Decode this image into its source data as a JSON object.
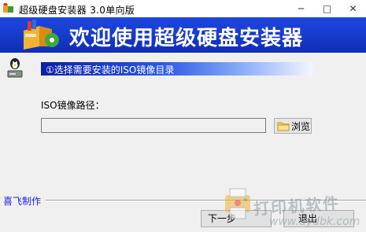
{
  "window": {
    "title": "超级硬盘安装器 3.0单向版",
    "minimize_glyph": "─",
    "maximize_glyph": "□",
    "close_glyph": "✕"
  },
  "banner": {
    "title": "欢迎使用超级硬盘安装器"
  },
  "step": {
    "label": "①选择需要安装的ISO镜像目录"
  },
  "form": {
    "path_label": "ISO镜像路径：",
    "path_value": "",
    "browse_label": "浏览",
    "browse_icon": "folder-icon"
  },
  "footer": {
    "author_link": "喜飞制作",
    "next_label": "下一步",
    "exit_label": "退出"
  },
  "watermark": {
    "text": "打印机软件",
    "url": "www.dydbk.com"
  },
  "colors": {
    "banner": "#1a3fd6",
    "step_start": "#0a1fa8",
    "link": "#1d1de0"
  }
}
